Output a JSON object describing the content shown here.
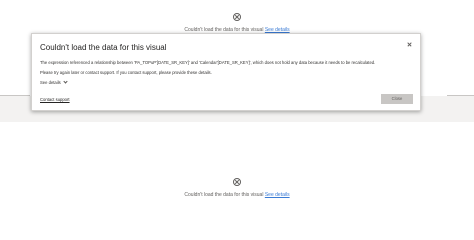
{
  "visual_top": {
    "message": "Couldn't load the data for this visual",
    "link": "See details"
  },
  "visual_bottom": {
    "message": "Couldn't load the data for this visual",
    "link": "See details"
  },
  "dialog": {
    "title": "Couldn't load the data for this visual",
    "line1": "The expression referenced a relationship between 'PA_TOPuP'[DATE_SR_KEY]' and 'Calendar'[DATE_SR_KEY]', which does not hold any data because it needs to be recalculated.",
    "line2": "Please try again later or contact support. If you contact support, please provide these details.",
    "see_details": "See details",
    "contact_support": "Contact support",
    "close_button": "Close"
  },
  "icons": {
    "error": "error-circle-x-icon",
    "close": "close-icon",
    "expand": "chevron-down-icon"
  },
  "colors": {
    "link": "#3a7bd5",
    "button_bg": "#c8c6c4"
  }
}
